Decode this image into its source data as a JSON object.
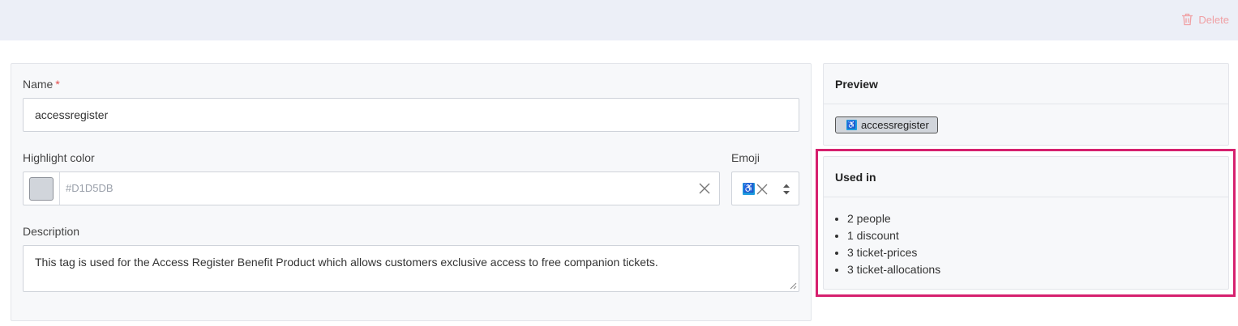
{
  "toolbar": {
    "delete_label": "Delete"
  },
  "form": {
    "name_label": "Name",
    "name_required": "*",
    "name_value": "accessregister",
    "color_label": "Highlight color",
    "color_value": "#D1D5DB",
    "swatch_color": "#D1D5DB",
    "emoji_label": "Emoji",
    "emoji_value": "♿",
    "description_label": "Description",
    "description_value": "This tag is used for the Access Register Benefit Product which allows customers exclusive access to free companion tickets."
  },
  "preview": {
    "title": "Preview",
    "tag_emoji": "♿",
    "tag_label": "accessregister"
  },
  "used_in": {
    "title": "Used in",
    "items": [
      "2 people",
      "1 discount",
      "3 ticket-prices",
      "3 ticket-allocations"
    ]
  },
  "colors": {
    "accent_highlight": "#D6206E",
    "delete_color": "#F0A0A4",
    "emoji_bg": "#1E9CE0"
  }
}
